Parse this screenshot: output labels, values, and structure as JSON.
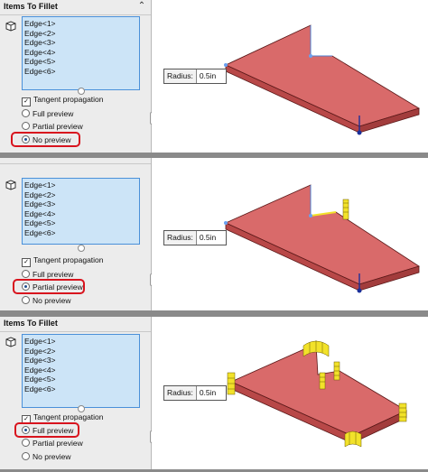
{
  "panels": [
    {
      "section_title": "Items To Fillet",
      "edges": [
        "Edge<1>",
        "Edge<2>",
        "Edge<3>",
        "Edge<4>",
        "Edge<5>",
        "Edge<6>"
      ],
      "tangent_label": "Tangent propagation",
      "tangent_checked": true,
      "options": [
        "Full preview",
        "Partial preview",
        "No preview"
      ],
      "selected_option": "No preview",
      "radius_label": "Radius:",
      "radius_value": "0.5in"
    },
    {
      "section_title": "",
      "edges": [
        "Edge<1>",
        "Edge<2>",
        "Edge<3>",
        "Edge<4>",
        "Edge<5>",
        "Edge<6>"
      ],
      "tangent_label": "Tangent propagation",
      "tangent_checked": true,
      "options": [
        "Full preview",
        "Partial preview",
        "No preview"
      ],
      "selected_option": "Partial preview",
      "radius_label": "Radius:",
      "radius_value": "0.5in"
    },
    {
      "section_title": "Items To Fillet",
      "edges": [
        "Edge<1>",
        "Edge<2>",
        "Edge<3>",
        "Edge<4>",
        "Edge<5>",
        "Edge<6>"
      ],
      "tangent_label": "Tangent propagation",
      "tangent_checked": true,
      "options": [
        "Full preview",
        "Partial preview",
        "No preview"
      ],
      "selected_option": "Full preview",
      "radius_label": "Radius:",
      "radius_value": "0.5in"
    }
  ],
  "colors": {
    "part_top": "#d96a6a",
    "part_side": "#b84848",
    "part_edge": "#5a1818",
    "preview": "#f2e22a",
    "highlight": "#d8141e",
    "selection_list": "#cce4f7"
  }
}
